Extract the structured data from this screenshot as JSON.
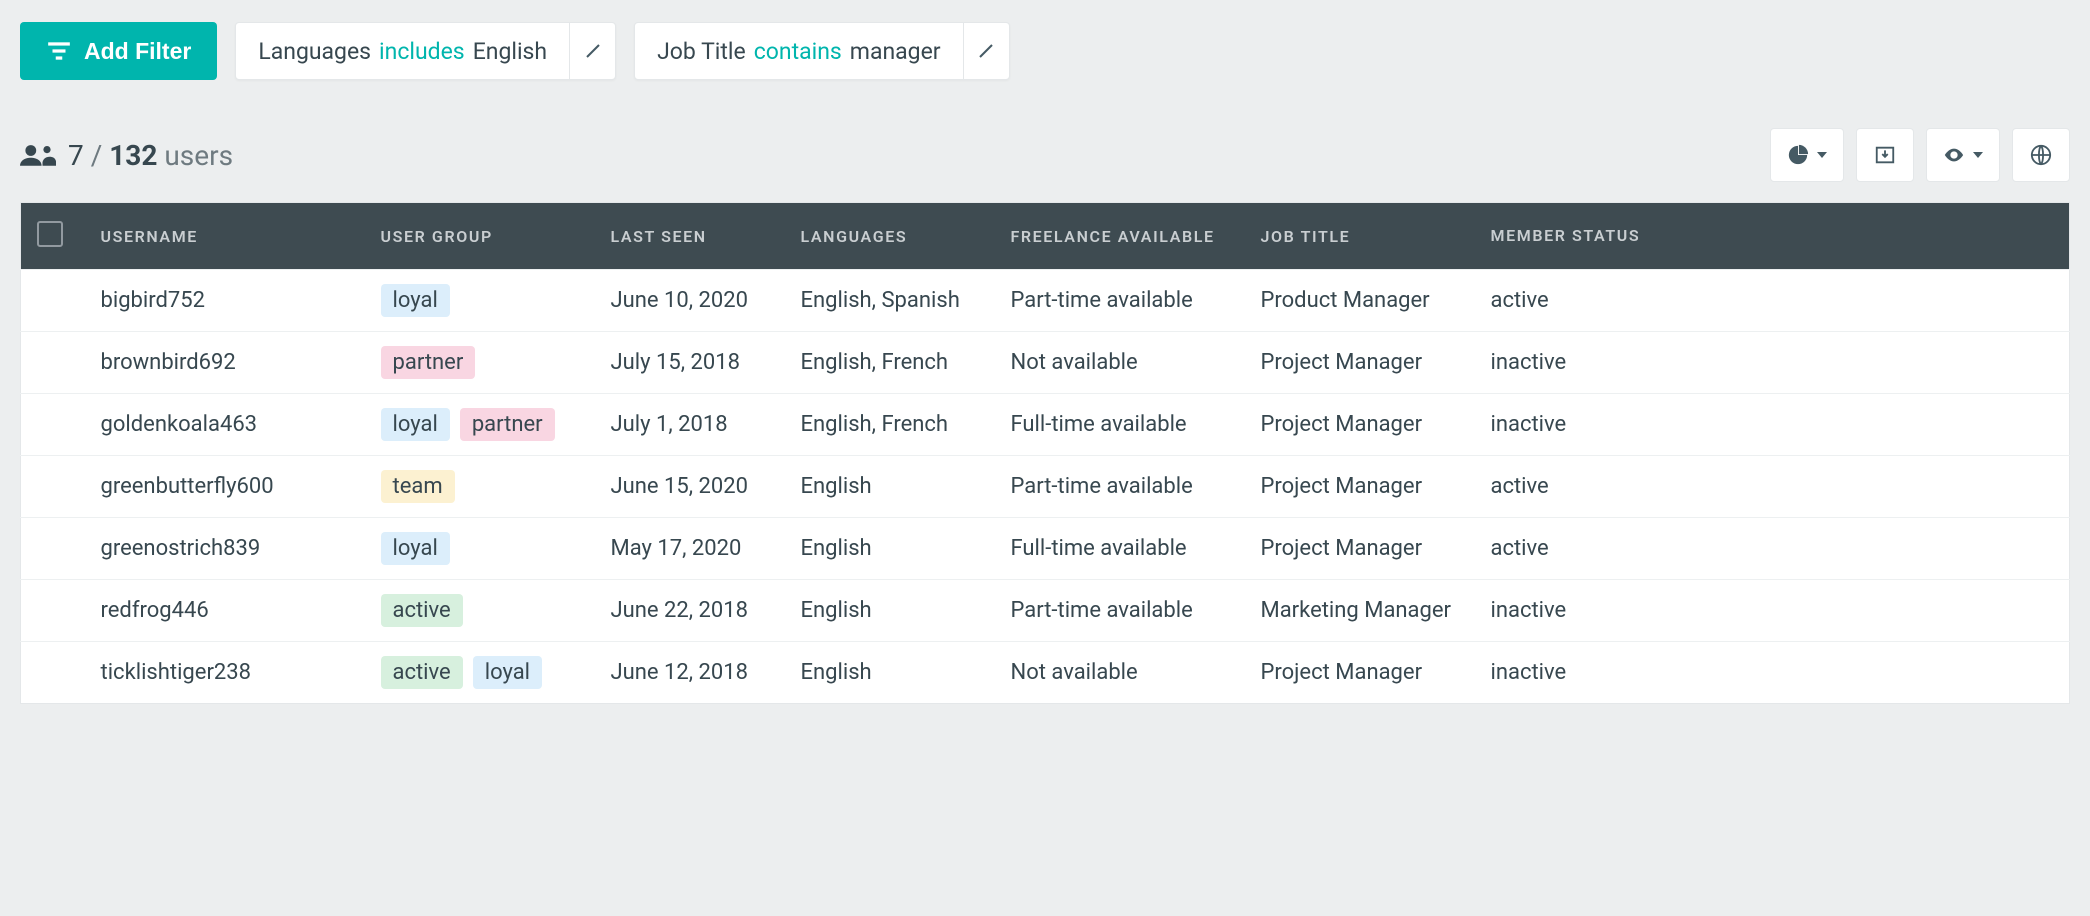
{
  "toolbar": {
    "add_filter_label": "Add Filter"
  },
  "filters": [
    {
      "field": "Languages",
      "op": "includes",
      "value": "English"
    },
    {
      "field": "Job Title",
      "op": "contains",
      "value": "manager"
    }
  ],
  "counts": {
    "filtered": "7",
    "total": "132",
    "sep": "/",
    "suffix": "users"
  },
  "tool_buttons": {
    "chart": "segment-chart-dropdown",
    "export": "export-button",
    "visibility": "columns-visibility-dropdown",
    "globe": "public-share-button"
  },
  "columns": {
    "username": "USERNAME",
    "user_group": "USER GROUP",
    "last_seen": "LAST SEEN",
    "languages": "LANGUAGES",
    "freelance": "FREELANCE AVAILABLE",
    "job_title": "JOB TITLE",
    "member_status": "MEMBER STATUS"
  },
  "tag_classes": {
    "loyal": "tag-loyal",
    "partner": "tag-partner",
    "team": "tag-team",
    "active": "tag-active"
  },
  "rows": [
    {
      "username": "bigbird752",
      "avatar": [
        "#f4d27a",
        "#d19d6c"
      ],
      "groups": [
        "loyal"
      ],
      "last_seen": "June 10, 2020",
      "languages": "English, Spanish",
      "freelance": "Part-time available",
      "job_title": "Product Manager",
      "member_status": "active"
    },
    {
      "username": "brownbird692",
      "avatar": [
        "#2c2c2c",
        "#6b4a3a"
      ],
      "groups": [
        "partner"
      ],
      "last_seen": "July 15, 2018",
      "languages": "English, French",
      "freelance": "Not available",
      "job_title": "Project Manager",
      "member_status": "inactive"
    },
    {
      "username": "goldenkoala463",
      "avatar": [
        "#5a3d2b",
        "#cfd4d8"
      ],
      "groups": [
        "loyal",
        "partner"
      ],
      "last_seen": "July 1, 2018",
      "languages": "English, French",
      "freelance": "Full-time available",
      "job_title": "Project Manager",
      "member_status": "inactive"
    },
    {
      "username": "greenbutterfly600",
      "avatar": [
        "#8e6b57",
        "#d6d2cb"
      ],
      "groups": [
        "team"
      ],
      "last_seen": "June 15, 2020",
      "languages": "English",
      "freelance": "Part-time available",
      "job_title": "Project Manager",
      "member_status": "active"
    },
    {
      "username": "greenostrich839",
      "avatar": [
        "#d7dbdd",
        "#9fa8ac"
      ],
      "groups": [
        "loyal"
      ],
      "last_seen": "May 17, 2020",
      "languages": "English",
      "freelance": "Full-time available",
      "job_title": "Project Manager",
      "member_status": "active"
    },
    {
      "username": "redfrog446",
      "avatar": [
        "#b14f3a",
        "#e8c9b0"
      ],
      "groups": [
        "active"
      ],
      "last_seen": "June 22, 2018",
      "languages": "English",
      "freelance": "Part-time available",
      "job_title": "Marketing Manager",
      "member_status": "inactive"
    },
    {
      "username": "ticklishtiger238",
      "avatar": [
        "#c48a56",
        "#e7d9c6"
      ],
      "groups": [
        "active",
        "loyal"
      ],
      "last_seen": "June 12, 2018",
      "languages": "English",
      "freelance": "Not available",
      "job_title": "Project Manager",
      "member_status": "inactive"
    }
  ]
}
